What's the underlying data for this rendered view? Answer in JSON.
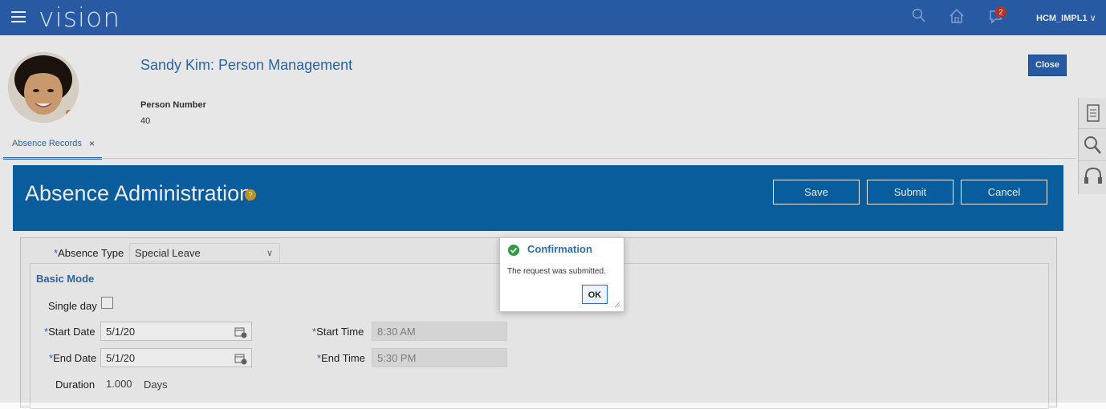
{
  "app": {
    "logo": "vision",
    "user": "HCM_IMPL1",
    "notification_count": "2"
  },
  "header": {
    "title": "Sandy Kim: Person Management",
    "person_number_label": "Person Number",
    "person_number": "40",
    "close_label": "Close"
  },
  "tabs": [
    {
      "label": "Absence Records",
      "close": "×"
    }
  ],
  "banner": {
    "title": "Absence Administration",
    "help": "?",
    "buttons": {
      "save": "Save",
      "submit": "Submit",
      "cancel": "Cancel"
    }
  },
  "form": {
    "absence_type_label": "Absence Type",
    "absence_type_value": "Special Leave",
    "basic_mode": "Basic Mode",
    "single_day_label": "Single day",
    "start_date_label": "Start Date",
    "start_date": "5/1/20",
    "end_date_label": "End Date",
    "end_date": "5/1/20",
    "start_time_label": "Start Time",
    "start_time": "8:30 AM",
    "end_time_label": "End Time",
    "end_time": "5:30 PM",
    "duration_label": "Duration",
    "duration_value": "1.000",
    "duration_unit": "Days",
    "required_mark": "*"
  },
  "dialog": {
    "title": "Confirmation",
    "message": "The request was submitted.",
    "ok_label": "OK"
  },
  "colors": {
    "topbar": "#2c61b1",
    "banner": "#0a65aa",
    "link": "#2d6cb0",
    "success": "#2e9c3e"
  }
}
